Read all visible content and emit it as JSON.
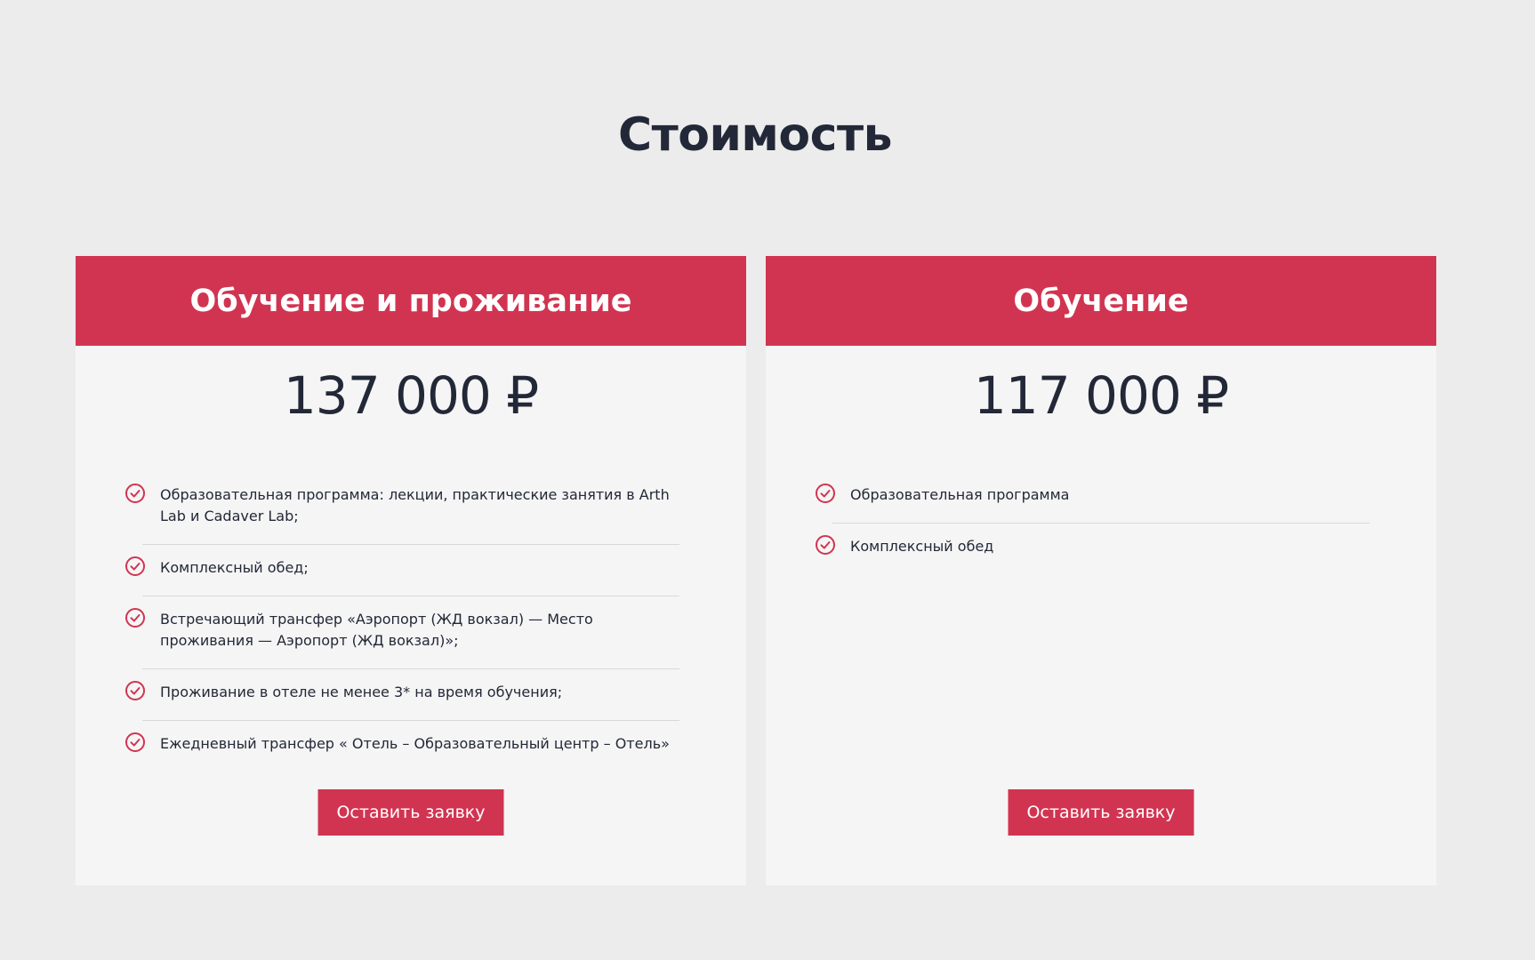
{
  "section": {
    "title": "Стоимость"
  },
  "cards": [
    {
      "title": "Обучение и проживание",
      "price": "137 000 ₽",
      "features": [
        "Образовательная программа: лекции, практические занятия в Arth Lab и Cadaver Lab;",
        "Комплексный обед;",
        "Встречающий трансфер «Аэропорт (ЖД вокзал) — Место проживания — Аэропорт (ЖД вокзал)»;",
        "Проживание в отеле не менее 3* на время обучения;",
        "Ежедневный трансфер « Отель – Образовательный центр – Отель»"
      ],
      "button_label": "Оставить заявку"
    },
    {
      "title": "Обучение",
      "price": "117 000 ₽",
      "features": [
        "Образовательная программа",
        "Комплексный обед"
      ],
      "button_label": "Оставить заявку"
    }
  ],
  "icons": {
    "feature_bullet": "check-circle-icon"
  },
  "colors": {
    "accent": "#d13451",
    "text": "#232838",
    "card_bg": "#f5f5f5",
    "page_bg": "#ececec"
  }
}
